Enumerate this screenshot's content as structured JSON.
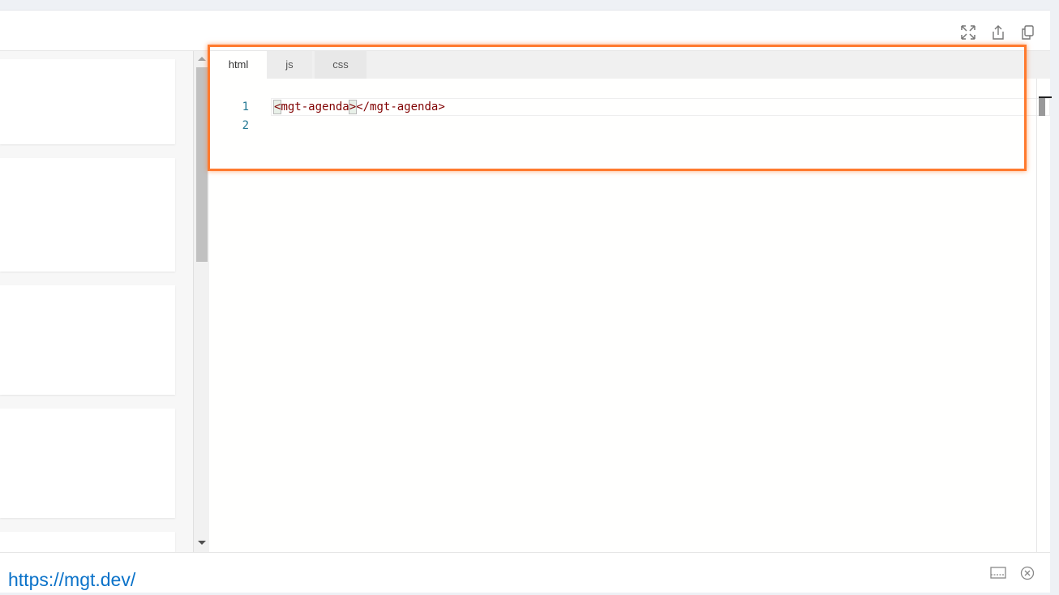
{
  "toolbar": {
    "icons": [
      "fullscreen-icon",
      "share-icon",
      "copy-icon"
    ]
  },
  "editor": {
    "tabs": [
      {
        "label": "html",
        "active": true
      },
      {
        "label": "js",
        "active": false
      },
      {
        "label": "css",
        "active": false
      }
    ],
    "lines": [
      {
        "number": "1",
        "open": "<",
        "tag1": "mgt-agenda",
        "close1": ">",
        "rest": "</mgt-agenda>"
      },
      {
        "number": "2"
      }
    ]
  },
  "footer": {
    "link": "https://mgt.dev/",
    "icons": [
      "panel-icon",
      "close-circle-icon"
    ]
  },
  "colors": {
    "highlight": "#ff7a2e",
    "link": "#0a72c9",
    "tag": "#800000",
    "line_number": "#237893"
  }
}
